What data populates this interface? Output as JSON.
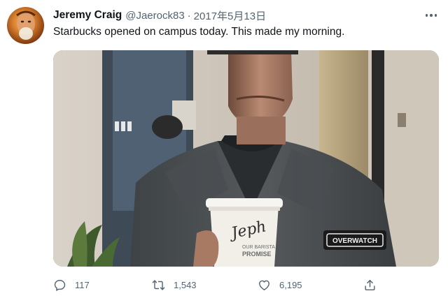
{
  "tweet": {
    "author_name": "Jeremy Craig",
    "handle": "@Jaerock83",
    "separator": "·",
    "date": "2017年5月13日",
    "text": "Starbucks opened on campus today. This made my morning.",
    "media": {
      "cup_handwriting": "Jeph",
      "cup_print_line1": "OUR BARISTA",
      "cup_print_line2": "PROMISE",
      "patch_text": "OVERWATCH"
    },
    "actions": {
      "reply_count": "117",
      "retweet_count": "1,543",
      "like_count": "6,195"
    }
  },
  "icons": {
    "more": "more-horizontal-icon",
    "reply": "reply-icon",
    "retweet": "retweet-icon",
    "like": "heart-icon",
    "share": "share-icon"
  },
  "colors": {
    "text_primary": "#0f1419",
    "text_secondary": "#536471",
    "background": "#ffffff"
  }
}
